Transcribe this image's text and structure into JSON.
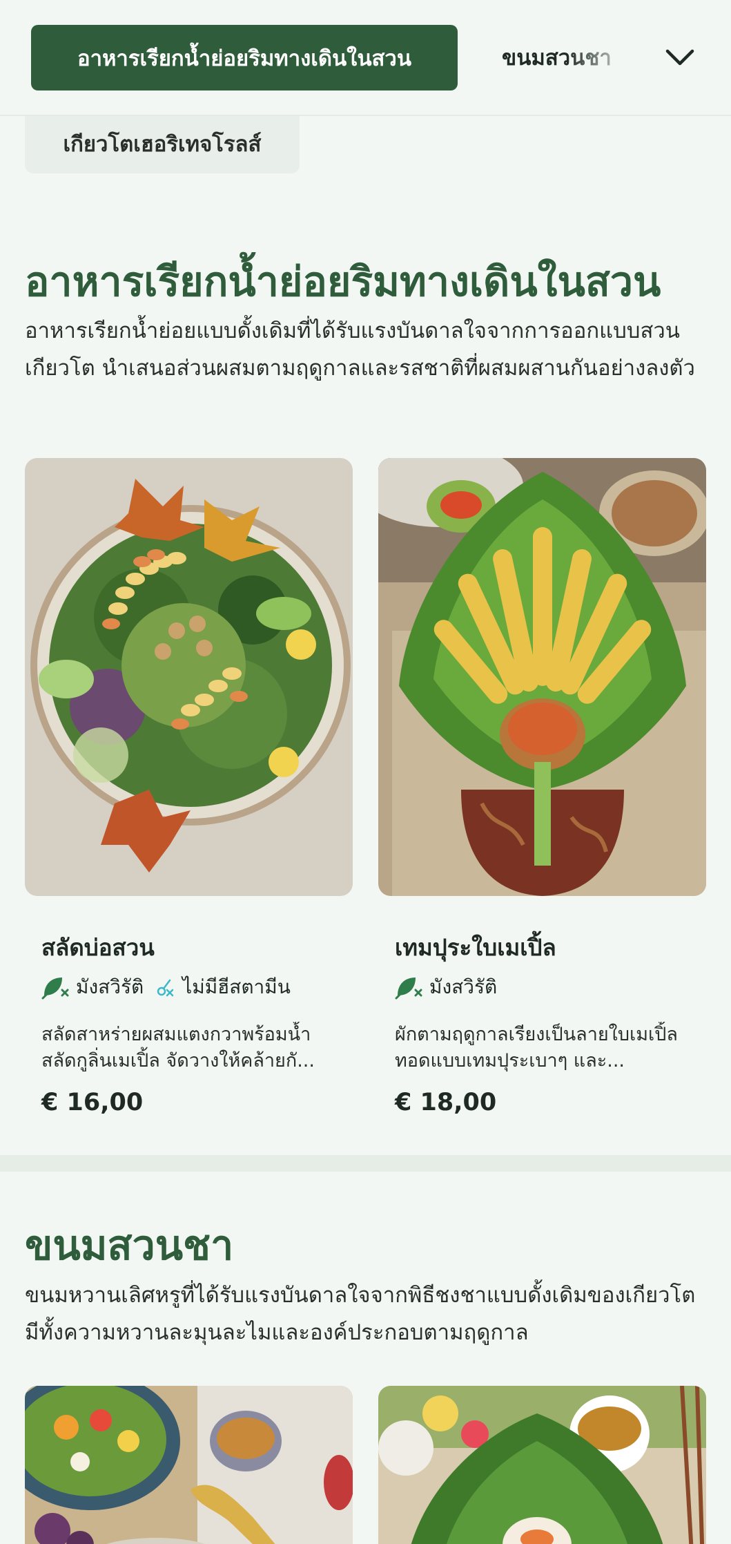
{
  "nav": {
    "active_tab": "อาหารเรียกน้ำย่อยริมทางเดินในสวน",
    "next_tab": "ขนมสวนชา",
    "dropdown_icon": "chevron-down-icon"
  },
  "chip": {
    "label": "เกียวโตเฮอริเทจโรลส์"
  },
  "appetizers": {
    "title": "อาหารเรียกน้ำย่อยริมทางเดินในสวน",
    "description": "อาหารเรียกน้ำย่อยแบบดั้งเดิมที่ได้รับแรงบันดาลใจจากการออกแบบสวนเกียวโต นำเสนอส่วนผสมตามฤดูกาลและรสชาติที่ผสมผสานกันอย่างลงตัว",
    "items": [
      {
        "name": "สลัดบ่อสวน",
        "tags": [
          {
            "icon": "vegan-leaf-icon",
            "label": "มังสวิรัติ"
          },
          {
            "icon": "no-shellfish-icon",
            "label": "ไม่มีฮีสตามีน"
          }
        ],
        "description": "สลัดสาหร่ายผสมแตงกวาพร้อมน้ำสลัดกูลิ่นเมเปิ้ล จัดวางให้คล้ายกั...",
        "price": "€ 16,00"
      },
      {
        "name": "เทมปุระใบเมเปิ้ล",
        "tags": [
          {
            "icon": "vegan-leaf-icon",
            "label": "มังสวิรัติ"
          }
        ],
        "description": "ผักตามฤดูกาลเรียงเป็นลายใบเมเปิ้ล ทอดแบบเทมปุระเบาๆ และ...",
        "price": "€ 18,00"
      }
    ]
  },
  "desserts": {
    "title": "ขนมสวนชา",
    "description": "ขนมหวานเลิศหรูที่ได้รับแรงบันดาลใจจากพิธีชงชาแบบดั้งเดิมของเกียวโต มีทั้งความหวานละมุนละไมและองค์ประกอบตามฤดูกาล"
  },
  "colors": {
    "brand_green": "#2f5d3c",
    "background": "#f3f7f3",
    "tag_green": "#2f7d4a",
    "tag_cyan": "#3cb8c8"
  }
}
